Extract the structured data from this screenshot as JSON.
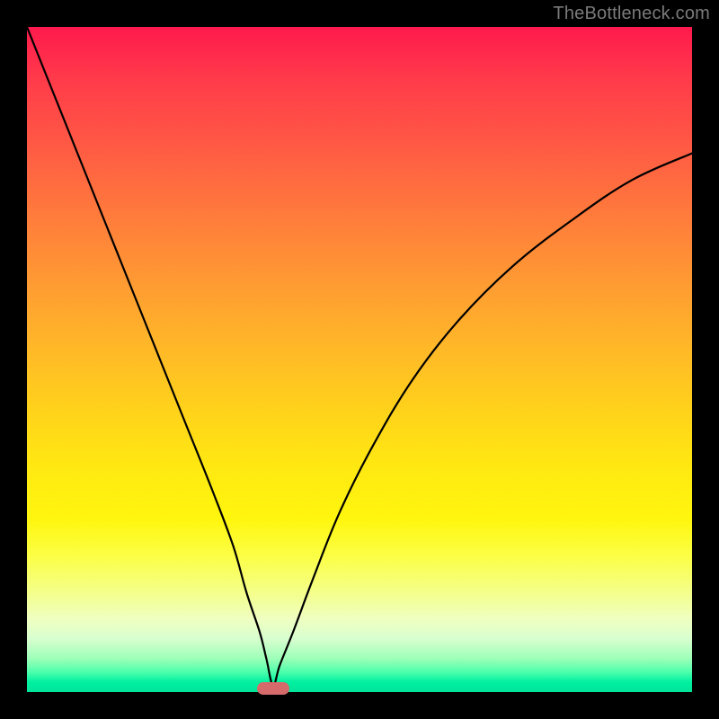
{
  "watermark": "TheBottleneck.com",
  "colors": {
    "frame": "#000000",
    "marker": "#d46a6a",
    "curve": "#000000"
  },
  "chart_data": {
    "type": "line",
    "title": "",
    "xlabel": "",
    "ylabel": "",
    "xlim": [
      0,
      100
    ],
    "ylim": [
      0,
      100
    ],
    "grid": false,
    "legend": false,
    "annotations": [
      {
        "name": "optimum-marker",
        "x": 37,
        "y": 0
      }
    ],
    "background_gradient": {
      "top_color": "#ff1a4d",
      "mid_color": "#ffe812",
      "bottom_color": "#00e49a",
      "meaning": "红色 = 高瓶颈, 绿色 = 低瓶颈"
    },
    "series": [
      {
        "name": "bottleneck-curve",
        "x": [
          0,
          4,
          8,
          12,
          16,
          20,
          24,
          28,
          31,
          33,
          35,
          36,
          37,
          38,
          40,
          43,
          47,
          52,
          58,
          65,
          73,
          82,
          91,
          100
        ],
        "y": [
          100,
          90,
          80,
          70,
          60,
          50,
          40,
          30,
          22,
          15,
          9,
          5,
          1,
          4,
          9,
          17,
          27,
          37,
          47,
          56,
          64,
          71,
          77,
          81
        ]
      }
    ]
  }
}
